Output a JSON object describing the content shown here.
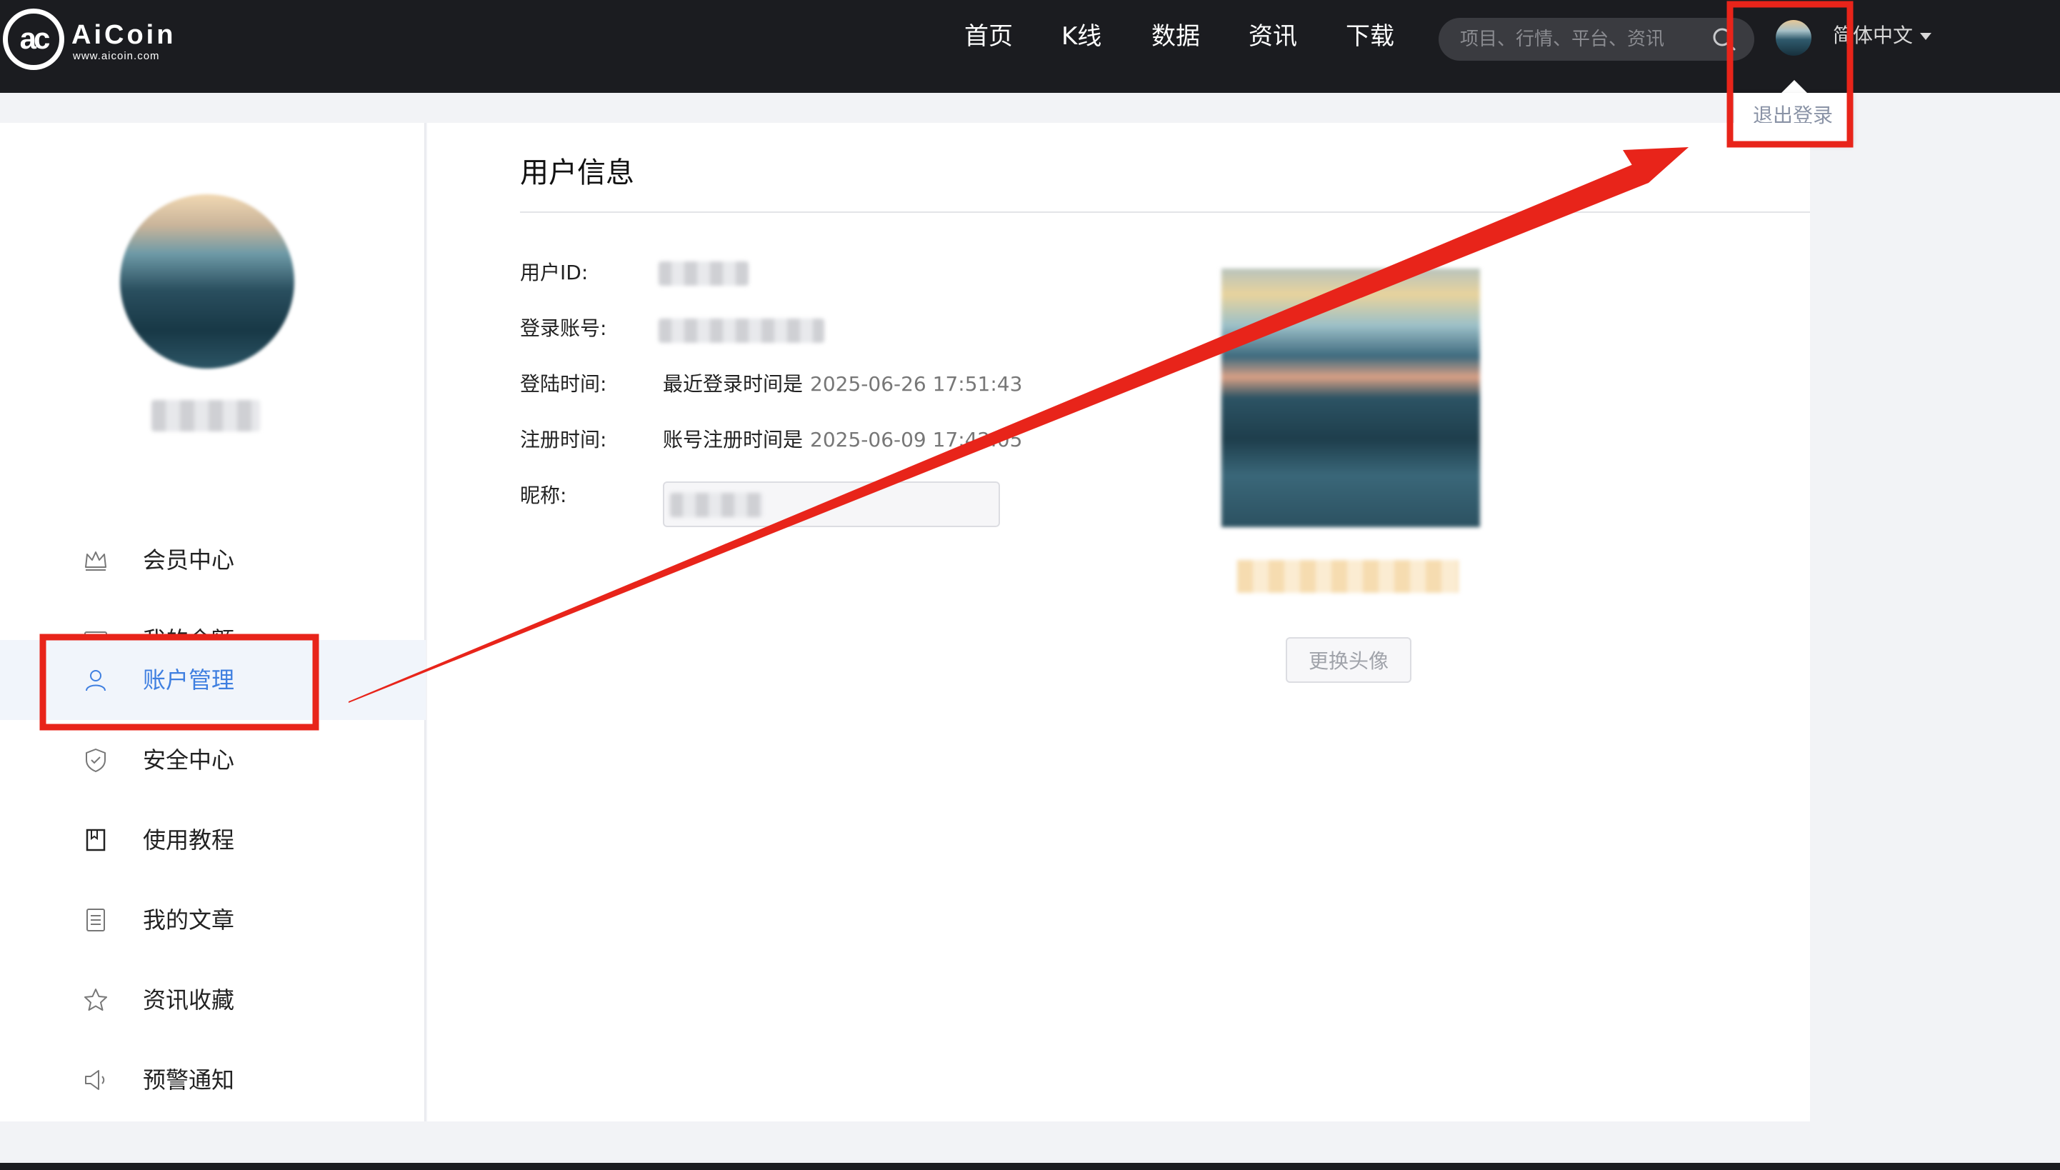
{
  "header": {
    "logo": {
      "name": "AiCoin",
      "url": "www.aicoin.com"
    },
    "nav": [
      "首页",
      "K线",
      "数据",
      "资讯",
      "下载"
    ],
    "search": {
      "placeholder": "项目、行情、平台、资讯",
      "icon": "search-icon"
    },
    "language": "简体中文",
    "dropdown": {
      "logout": "退出登录"
    }
  },
  "sidebar": {
    "items": [
      {
        "label": "会员中心",
        "icon": "crown-icon",
        "active": false
      },
      {
        "label": "我的余额",
        "icon": "wallet-icon",
        "active": false
      },
      {
        "label": "账户管理",
        "icon": "user-icon",
        "active": true
      },
      {
        "label": "安全中心",
        "icon": "shield-icon",
        "active": false
      },
      {
        "label": "使用教程",
        "icon": "bookmark-icon",
        "active": false
      },
      {
        "label": "我的文章",
        "icon": "document-icon",
        "active": false
      },
      {
        "label": "资讯收藏",
        "icon": "star-icon",
        "active": false
      },
      {
        "label": "预警通知",
        "icon": "speaker-icon",
        "active": false
      }
    ]
  },
  "main": {
    "title": "用户信息",
    "fields": {
      "user_id_label": "用户ID:",
      "account_label": "登录账号:",
      "login_time_label": "登陆时间:",
      "login_time_prefix": "最近登录时间是",
      "login_time_value": "2025-06-26 17:51:43",
      "register_time_label": "注册时间:",
      "register_time_prefix": "账号注册时间是",
      "register_time_value": "2025-06-09 17:42:05",
      "nickname_label": "昵称:"
    },
    "change_avatar": "更换头像"
  },
  "colors": {
    "topbar": "#1b1c20",
    "accent": "#3f7fe0",
    "annotation": "#e8241a"
  }
}
